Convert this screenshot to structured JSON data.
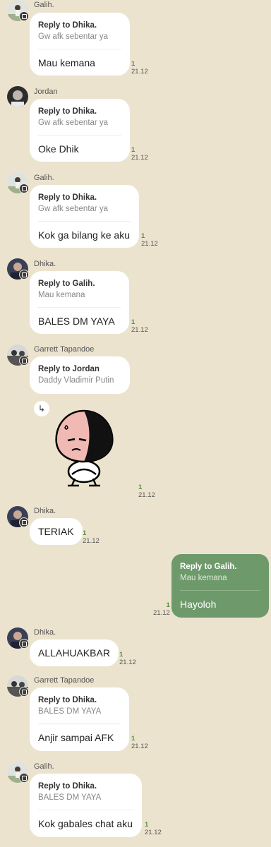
{
  "messages": [
    {
      "sender": "Galih.",
      "reply_title": "Reply to Dhika.",
      "reply_quote": "Gw afk sebentar ya",
      "text": "Mau kemana",
      "read": "1",
      "time": "21.12"
    },
    {
      "sender": "Jordan",
      "reply_title": "Reply to Dhika.",
      "reply_quote": "Gw afk sebentar ya",
      "text": "Oke Dhik",
      "read": "1",
      "time": "21.12"
    },
    {
      "sender": "Galih.",
      "reply_title": "Reply to Dhika.",
      "reply_quote": "Gw afk sebentar ya",
      "text": "Kok ga bilang ke aku",
      "read": "1",
      "time": "21.12"
    },
    {
      "sender": "Dhika.",
      "reply_title": "Reply to Galih.",
      "reply_quote": "Mau kemana",
      "text": "BALES DM YAYA",
      "read": "1",
      "time": "21.12"
    },
    {
      "sender": "Garrett Tapandoe",
      "reply_title": "Reply to Jordan",
      "reply_quote": "Daddy Vladimir Putin",
      "share_icon": "share-arrow-icon",
      "sticker": "peach-character-sticker",
      "read": "1",
      "time": "21.12"
    },
    {
      "sender": "Dhika.",
      "text": "TERIAK",
      "read": "1",
      "time": "21.12"
    },
    {
      "outgoing": true,
      "reply_title": "Reply to Galih.",
      "reply_quote": "Mau kemana",
      "text": "Hayoloh",
      "read": "1",
      "time": "21.12"
    },
    {
      "sender": "Dhika.",
      "text": "ALLAHUAKBAR",
      "read": "1",
      "time": "21.12"
    },
    {
      "sender": "Garrett Tapandoe",
      "reply_title": "Reply to Dhika.",
      "reply_quote": "BALES DM YAYA",
      "text": "Anjir sampai AFK",
      "read": "1",
      "time": "21.12"
    },
    {
      "sender": "Galih.",
      "reply_title": "Reply to Dhika.",
      "reply_quote": "BALES DM YAYA",
      "text": "Kok gabales chat aku",
      "read": "1",
      "time": "21.12"
    }
  ],
  "colors": {
    "background": "#ece3cf",
    "outgoing_bubble": "#6e9a6b",
    "incoming_bubble": "#ffffff",
    "read_indicator": "#5b8d3f"
  }
}
